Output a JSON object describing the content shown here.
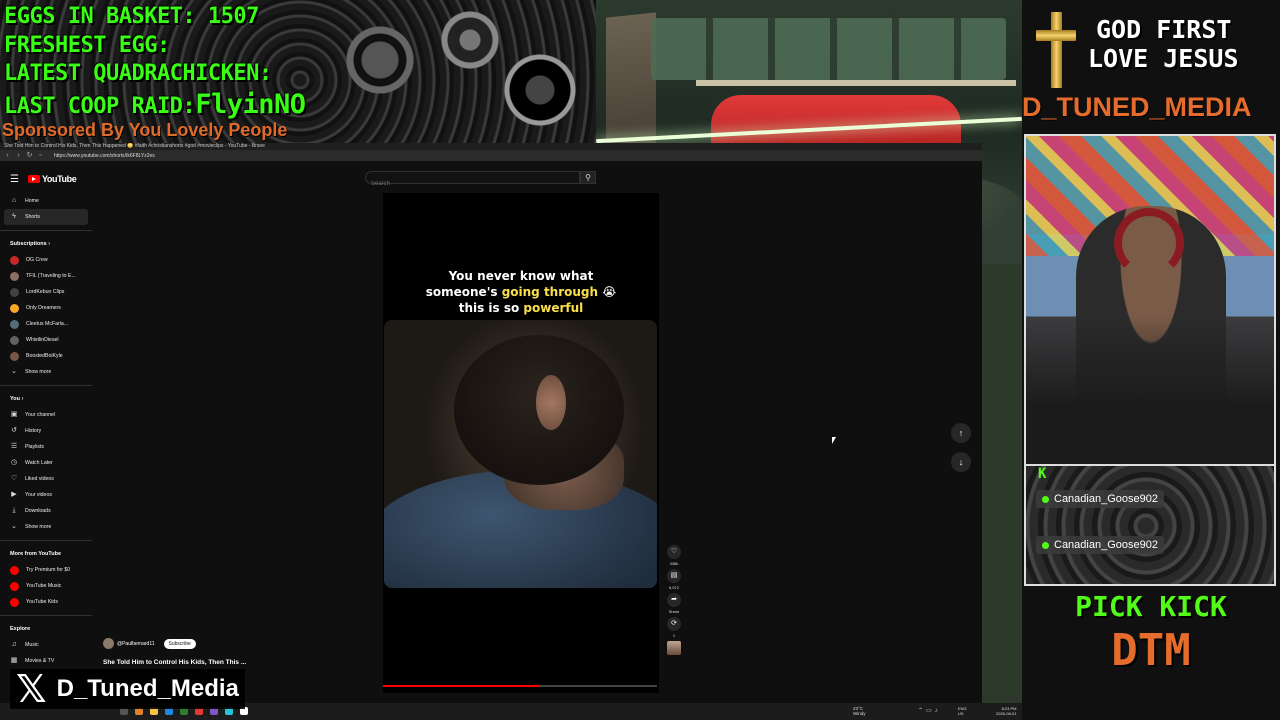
{
  "overlay": {
    "eggs_label": "EGGS IN BASKET: 1507",
    "freshest_label": "FRESHEST EGG:",
    "quad_label": "LATEST QUADRACHICKEN:",
    "raid_label": "LAST COOP RAID:",
    "raid_name": "FlyinNO",
    "sponsor": "Sponsored By You Lovely People"
  },
  "browser": {
    "window_title": "She Told Him to Control His Kids, Then This Happened 😳 #faith #christianshorts #god #movieclips - YouTube - Brave",
    "url": "https://www.youtube.com/shorts/Ik6F8LYz2es"
  },
  "youtube": {
    "logo_text": "YouTube",
    "search_placeholder": "Search",
    "sidebar": {
      "home": "Home",
      "shorts": "Shorts",
      "subscriptions_header": "Subscriptions",
      "subscriptions": [
        {
          "label": "OG Crew",
          "color": "#c62828"
        },
        {
          "label": "TFIL (Traveling to E...",
          "color": "#8d6e63"
        },
        {
          "label": "LordKebun Clips",
          "color": "#424242"
        },
        {
          "label": "Only Dreamers",
          "color": "#f9a825"
        },
        {
          "label": "Cleetus McFarla...",
          "color": "#546e7a"
        },
        {
          "label": "WhistlinDiesel",
          "color": "#616161"
        },
        {
          "label": "BoostedBoiKyle",
          "color": "#795548"
        }
      ],
      "show_more_1": "Show more",
      "you_header": "You",
      "you_items": [
        {
          "label": "Your channel",
          "icon": "▣"
        },
        {
          "label": "History",
          "icon": "↺"
        },
        {
          "label": "Playlists",
          "icon": "☰"
        },
        {
          "label": "Watch Later",
          "icon": "◷"
        },
        {
          "label": "Liked videos",
          "icon": "♡"
        },
        {
          "label": "Your videos",
          "icon": "▶"
        },
        {
          "label": "Downloads",
          "icon": "⤓"
        }
      ],
      "show_more_2": "Show more",
      "more_header": "More from YouTube",
      "more_items": [
        {
          "label": "Try Premium for $0"
        },
        {
          "label": "YouTube Music"
        },
        {
          "label": "YouTube Kids"
        }
      ],
      "explore_header": "Explore",
      "explore_items": [
        {
          "label": "Music",
          "icon": "♫"
        },
        {
          "label": "Movies & TV",
          "icon": "▦"
        }
      ]
    },
    "short": {
      "caption_line1": "You never know what",
      "caption_line2a": "someone's ",
      "caption_line2b": "going through",
      "caption_line2c": " 😭",
      "caption_line3a": "this is so ",
      "caption_line3b": "powerful",
      "channel": "@Paulbernard11",
      "subscribe": "Subscribe",
      "title": "She Told Him to Control His Kids, Then This ...",
      "progress_fraction": 0.57,
      "likes": "438k",
      "comments": "6,572",
      "share": "Share",
      "remix": "1"
    }
  },
  "right_panel": {
    "line1": "GOD FIRST",
    "line2": "LOVE JESUS",
    "brand": "D_TUNED_MEDIA",
    "chat": [
      {
        "user": "Canadian_Goose902"
      },
      {
        "user": "Canadian_Goose902"
      }
    ],
    "kick_k": "K",
    "pick_kick": "PICK KICK",
    "dtm": "DTM"
  },
  "x_badge": {
    "icon": "𝕏",
    "name": "D_Tuned_Media"
  },
  "taskbar": {
    "weather_temp": "23°C",
    "weather_desc": "Windy",
    "lang1": "ENG",
    "lang2": "US",
    "time": "8:23 PM",
    "date": "2026-08-01"
  }
}
